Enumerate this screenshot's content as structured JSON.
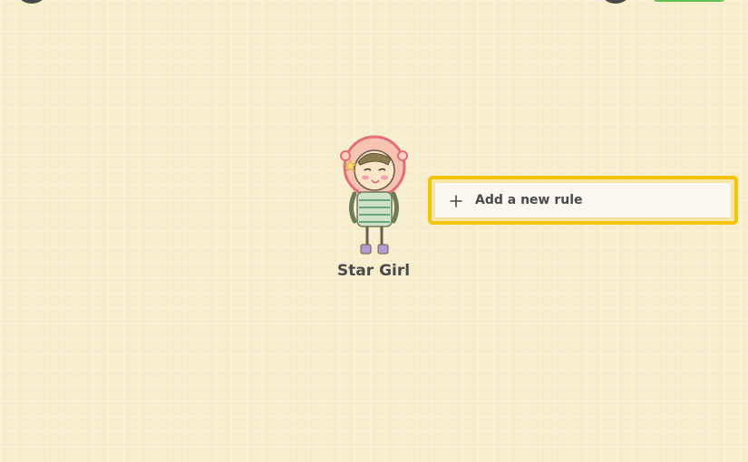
{
  "character": {
    "name": "Star Girl"
  },
  "rules": {
    "add_label": "Add a new rule"
  },
  "colors": {
    "background": "#f8eece",
    "highlight": "#f2c40a",
    "text": "#4a4a4a",
    "accent_green": "#5fbf4f"
  },
  "icons": {
    "add": "plus-icon",
    "character": "star-girl-sprite"
  }
}
